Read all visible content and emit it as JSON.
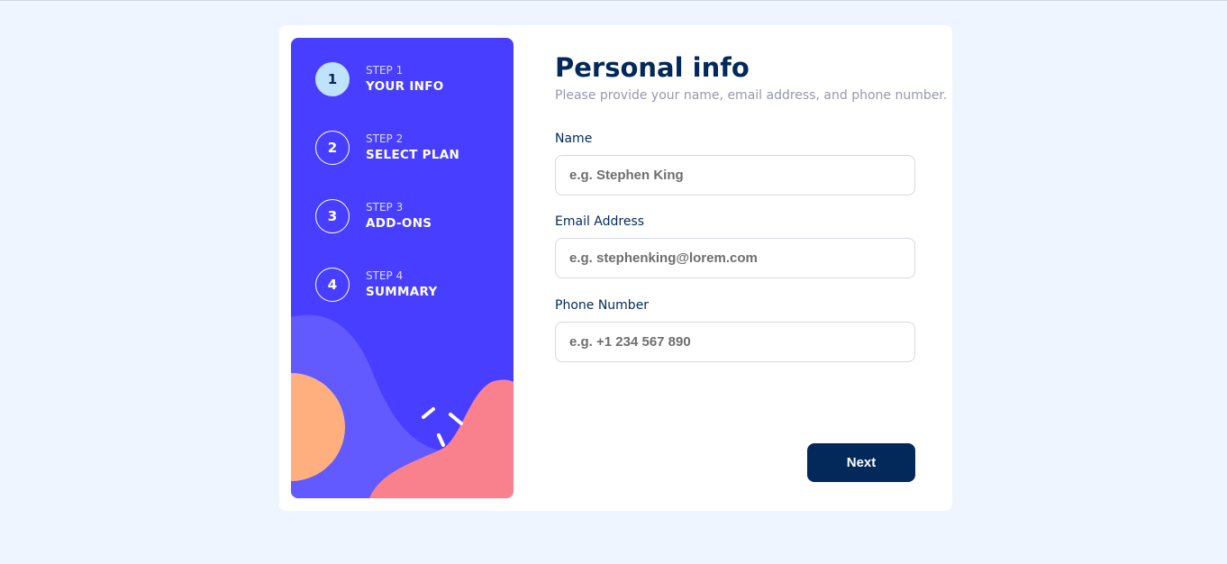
{
  "sidebar": {
    "steps": [
      {
        "number": "1",
        "label": "STEP 1",
        "title": "YOUR INFO",
        "active": true
      },
      {
        "number": "2",
        "label": "STEP 2",
        "title": "SELECT PLAN",
        "active": false
      },
      {
        "number": "3",
        "label": "STEP 3",
        "title": "ADD-ONS",
        "active": false
      },
      {
        "number": "4",
        "label": "STEP 4",
        "title": "SUMMARY",
        "active": false
      }
    ]
  },
  "form": {
    "title": "Personal info",
    "subtitle": "Please provide your name, email address, and phone number.",
    "name": {
      "label": "Name",
      "placeholder": "e.g. Stephen King",
      "value": ""
    },
    "email": {
      "label": "Email Address",
      "placeholder": "e.g. stephenking@lorem.com",
      "value": ""
    },
    "phone": {
      "label": "Phone Number",
      "placeholder": "e.g. +1 234 567 890",
      "value": ""
    },
    "next_label": "Next"
  },
  "colors": {
    "sidebar_bg": "#483eff",
    "active_step": "#bfe2fd",
    "primary": "#02295a",
    "page_bg": "#eff5ff"
  }
}
